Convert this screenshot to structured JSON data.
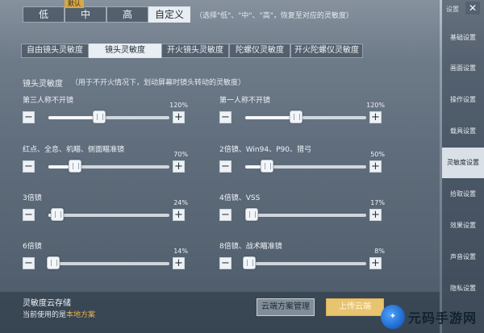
{
  "preset": {
    "options": [
      "低",
      "中",
      "高",
      "自定义"
    ],
    "default_badge": "默认",
    "hint": "（选择\"低\"、\"中\"、\"高\"，恢复至对应的灵敏度）"
  },
  "side_menu": {
    "top_label": "设置",
    "close_glyph": "✕",
    "items": [
      "基础设置",
      "画面设置",
      "操作设置",
      "载具设置",
      "灵敏度设置",
      "拾取设置",
      "效果设置",
      "声音设置",
      "隐私设置"
    ]
  },
  "tabs": [
    "自由镜头灵敏度",
    "镜头灵敏度",
    "开火镜头灵敏度",
    "陀螺仪灵敏度",
    "开火陀螺仪灵敏度"
  ],
  "section": {
    "title": "镜头灵敏度",
    "hint": "（用于不开火情况下，划动屏幕时镜头转动的灵敏度）"
  },
  "sliders": [
    {
      "label": "第三人称不开镜",
      "value": "120%",
      "fraction": 0.42
    },
    {
      "label": "第一人称不开镜",
      "value": "120%",
      "fraction": 0.42
    },
    {
      "label": "红点、全息、机瞄、侧面瞄准镜",
      "value": "70%",
      "fraction": 0.22
    },
    {
      "label": "2倍镜、Win94、P90、猎弓",
      "value": "50%",
      "fraction": 0.18
    },
    {
      "label": "3倍镜",
      "value": "24%",
      "fraction": 0.07
    },
    {
      "label": "4倍镜、VSS",
      "value": "17%",
      "fraction": 0.05
    },
    {
      "label": "6倍镜",
      "value": "14%",
      "fraction": 0.04
    },
    {
      "label": "8倍镜、战术瞄准镜",
      "value": "8%",
      "fraction": 0.03
    }
  ],
  "step": {
    "minus": "−",
    "plus": "+"
  },
  "cloud": {
    "title": "灵敏度云存储",
    "current_prefix": "当前使用的是",
    "current_plan": "本地方案",
    "manage_label": "云端方案管理",
    "upload_label": "上传云端"
  },
  "watermark": {
    "logo": "✦",
    "text": "元码手游网"
  }
}
